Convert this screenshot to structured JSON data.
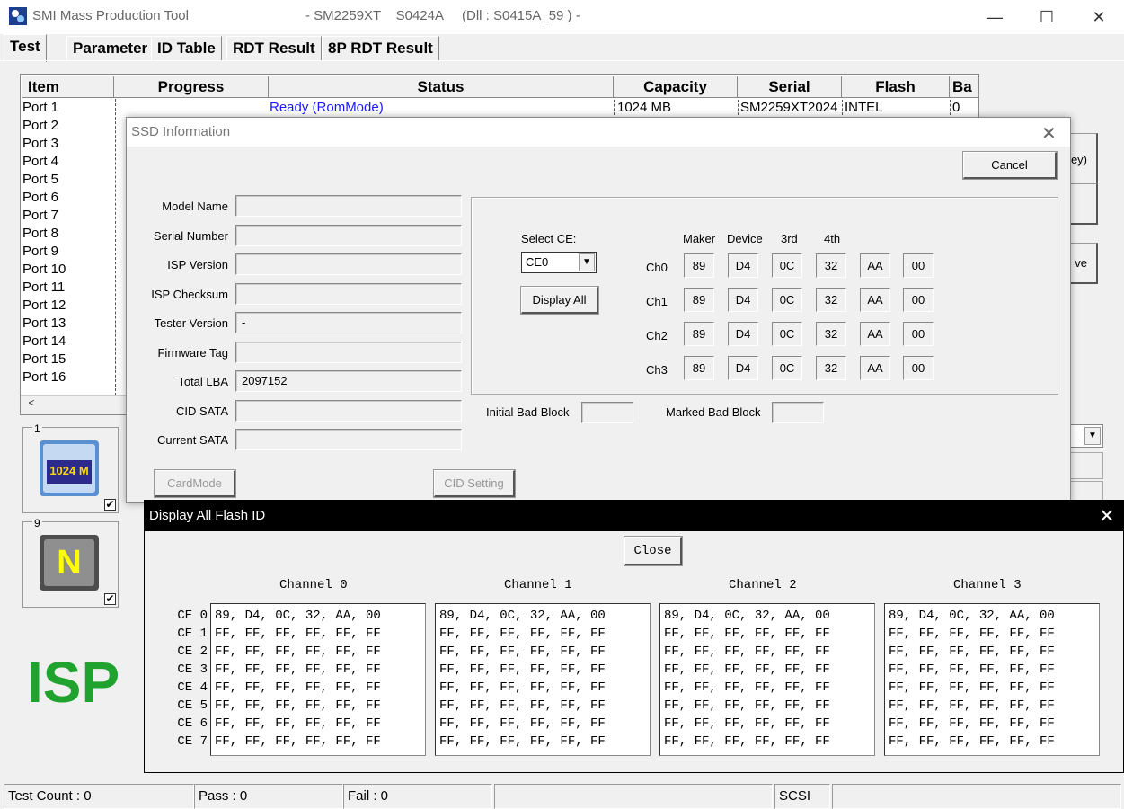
{
  "window": {
    "title": "SMI Mass Production Tool",
    "subtitle": "- SM2259XT    S0424A     (Dll : S0415A_59 ) -",
    "min_glyph": "—",
    "max_glyph": "☐",
    "close_glyph": "✕"
  },
  "tabs": [
    "Test",
    "Parameter",
    "ID Table",
    "RDT Result",
    "8P RDT Result"
  ],
  "table": {
    "headers": [
      "Item",
      "Progress",
      "Status",
      "Capacity",
      "Serial",
      "Flash",
      "Ba"
    ],
    "ports": [
      "Port 1",
      "Port 2",
      "Port 3",
      "Port 4",
      "Port 5",
      "Port 6",
      "Port 7",
      "Port 8",
      "Port 9",
      "Port 10",
      "Port 11",
      "Port 12",
      "Port 13",
      "Port 14",
      "Port 15",
      "Port 16"
    ],
    "row1": {
      "status": "Ready (RomMode)",
      "capacity": "1024 MB",
      "serial": "SM2259XT2024",
      "flash": "INTEL",
      "ba": "0"
    },
    "scroll_left": "<"
  },
  "right_buttons": {
    "btn1": "ey)",
    "btn3": "ve"
  },
  "cards": [
    {
      "num": "1",
      "label": "1024 M",
      "checked": "✔"
    },
    {
      "num": "9",
      "label": "N",
      "checked": "✔"
    }
  ],
  "isp_text": "ISP",
  "status_bar": {
    "test_count": "Test Count : 0",
    "pass": "Pass : 0",
    "fail": "Fail : 0",
    "mode": "SCSI"
  },
  "ssd_dialog": {
    "title": "SSD Information",
    "close": "✕",
    "cancel": "Cancel",
    "fields": [
      {
        "label": "Model Name",
        "value": ""
      },
      {
        "label": "Serial Number",
        "value": ""
      },
      {
        "label": "ISP Version",
        "value": ""
      },
      {
        "label": "ISP Checksum",
        "value": ""
      },
      {
        "label": "Tester Version",
        "value": "-"
      },
      {
        "label": "Firmware Tag",
        "value": ""
      },
      {
        "label": "Total LBA",
        "value": "2097152"
      },
      {
        "label": "CID SATA",
        "value": ""
      },
      {
        "label": "Current SATA",
        "value": ""
      }
    ],
    "select_ce_label": "Select CE:",
    "select_ce_value": "CE0",
    "display_all": "Display All",
    "col_headers": [
      "Maker",
      "Device",
      "3rd",
      "4th"
    ],
    "channels": [
      {
        "label": "Ch0",
        "ids": [
          "89",
          "D4",
          "0C",
          "32",
          "AA",
          "00"
        ]
      },
      {
        "label": "Ch1",
        "ids": [
          "89",
          "D4",
          "0C",
          "32",
          "AA",
          "00"
        ]
      },
      {
        "label": "Ch2",
        "ids": [
          "89",
          "D4",
          "0C",
          "32",
          "AA",
          "00"
        ]
      },
      {
        "label": "Ch3",
        "ids": [
          "89",
          "D4",
          "0C",
          "32",
          "AA",
          "00"
        ]
      }
    ],
    "initial_bad_block": "Initial Bad Block",
    "marked_bad_block": "Marked Bad Block",
    "card_mode": "CardMode",
    "cid_setting": "CID Setting"
  },
  "flash_id_dialog": {
    "title": "Display All Flash ID",
    "close_x": "✕",
    "close_btn": "Close",
    "channel_heads": [
      "Channel 0",
      "Channel 1",
      "Channel 2",
      "Channel 3"
    ],
    "ce_labels": [
      "CE 0",
      "CE 1",
      "CE 2",
      "CE 3",
      "CE 4",
      "CE 5",
      "CE 6",
      "CE 7"
    ],
    "channel_lists": [
      "89, D4, 0C, 32, AA, 00\nFF, FF, FF, FF, FF, FF\nFF, FF, FF, FF, FF, FF\nFF, FF, FF, FF, FF, FF\nFF, FF, FF, FF, FF, FF\nFF, FF, FF, FF, FF, FF\nFF, FF, FF, FF, FF, FF\nFF, FF, FF, FF, FF, FF",
      "89, D4, 0C, 32, AA, 00\nFF, FF, FF, FF, FF, FF\nFF, FF, FF, FF, FF, FF\nFF, FF, FF, FF, FF, FF\nFF, FF, FF, FF, FF, FF\nFF, FF, FF, FF, FF, FF\nFF, FF, FF, FF, FF, FF\nFF, FF, FF, FF, FF, FF",
      "89, D4, 0C, 32, AA, 00\nFF, FF, FF, FF, FF, FF\nFF, FF, FF, FF, FF, FF\nFF, FF, FF, FF, FF, FF\nFF, FF, FF, FF, FF, FF\nFF, FF, FF, FF, FF, FF\nFF, FF, FF, FF, FF, FF\nFF, FF, FF, FF, FF, FF",
      "89, D4, 0C, 32, AA, 00\nFF, FF, FF, FF, FF, FF\nFF, FF, FF, FF, FF, FF\nFF, FF, FF, FF, FF, FF\nFF, FF, FF, FF, FF, FF\nFF, FF, FF, FF, FF, FF\nFF, FF, FF, FF, FF, FF\nFF, FF, FF, FF, FF, FF"
    ]
  }
}
